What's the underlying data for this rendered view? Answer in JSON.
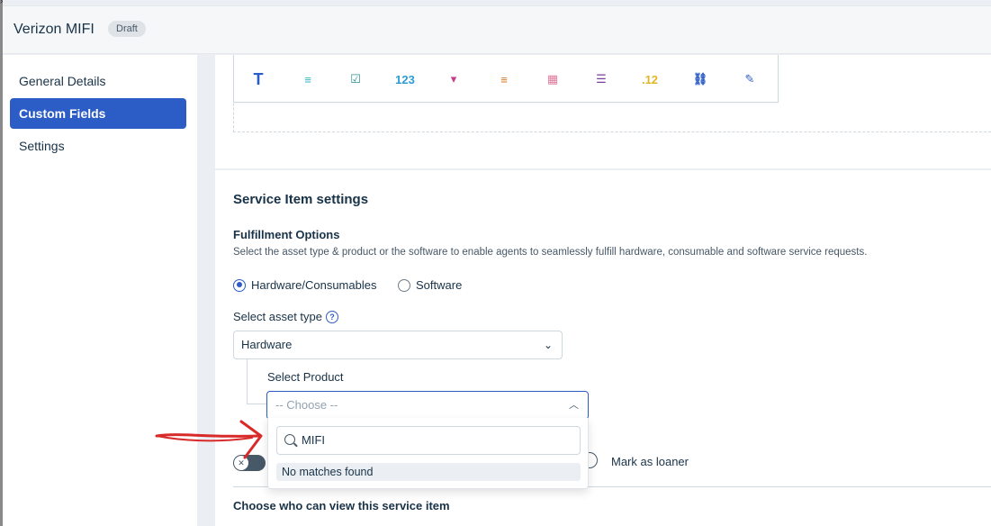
{
  "header": {
    "title": "Verizon MIFI",
    "badge": "Draft"
  },
  "sidebar": {
    "items": [
      {
        "label": "General Details",
        "active": false
      },
      {
        "label": "Custom Fields",
        "active": true
      },
      {
        "label": "Settings",
        "active": false
      }
    ]
  },
  "toolbar": {
    "tools": [
      {
        "icon": "text-field-icon",
        "glyph": "T",
        "color": "#2c5cc5"
      },
      {
        "icon": "paragraph-icon",
        "glyph": "≡",
        "color": "#30b5c0"
      },
      {
        "icon": "checkbox-icon",
        "glyph": "☑",
        "color": "#2c8f8c"
      },
      {
        "icon": "number-icon",
        "glyph": "123",
        "color": "#2c9bd6"
      },
      {
        "icon": "dropdown-icon",
        "glyph": "▾",
        "color": "#c43e8b"
      },
      {
        "icon": "dependent-field-icon",
        "glyph": "≡",
        "color": "#d97a1d"
      },
      {
        "icon": "date-icon",
        "glyph": "▦",
        "color": "#e07a9a"
      },
      {
        "icon": "multi-select-icon",
        "glyph": "☰",
        "color": "#7a3e9e"
      },
      {
        "icon": "decimal-icon",
        "glyph": ".12",
        "color": "#e0b526"
      },
      {
        "icon": "link-icon",
        "glyph": "⛓",
        "color": "#2c5cc5"
      },
      {
        "icon": "edit-icon",
        "glyph": "✎",
        "color": "#2c5cc5"
      }
    ]
  },
  "service_item": {
    "section_title": "Service Item settings",
    "fulfillment_title": "Fulfillment Options",
    "fulfillment_help": "Select the asset type & product or the software to enable agents to seamlessly fulfill hardware, consumable and software service requests.",
    "radio_hardware": "Hardware/Consumables",
    "radio_software": "Software",
    "asset_type_label": "Select asset type",
    "asset_type_value": "Hardware",
    "product_label": "Select Product",
    "product_placeholder": "-- Choose --",
    "dropdown_search_value": "MIFI",
    "dropdown_empty": "No matches found",
    "loaner_label": "Mark as loaner",
    "visibility_title": "Choose who can view this service item"
  },
  "colors": {
    "primary": "#2c5cc5",
    "annotation": "#d92a2a"
  }
}
